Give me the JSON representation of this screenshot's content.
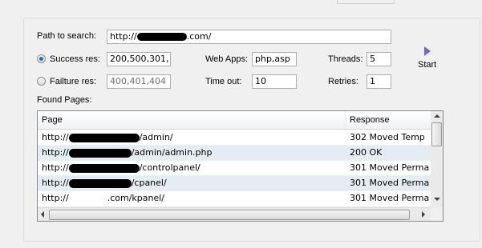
{
  "form": {
    "path_label": "Path to search:",
    "path_value_prefix": "http://",
    "path_value_suffix": ".com/",
    "success_label": "Success res:",
    "success_value": "200,500,301,",
    "failure_label": "Failture res:",
    "failure_value": "400,401,404",
    "webapps_label": "Web Apps:",
    "webapps_value": "php,asp",
    "timeout_label": "Time out:",
    "timeout_value": "10",
    "threads_label": "Threads:",
    "threads_value": "5",
    "retries_label": "Retries:",
    "retries_value": "1",
    "start_label": "Start",
    "found_label": "Found Pages:",
    "selected_mode": "success"
  },
  "table": {
    "headers": [
      "Page",
      "Response"
    ],
    "rows": [
      {
        "prefix": "http://",
        "suffix": "/admin/",
        "response": "302 Moved Temp"
      },
      {
        "prefix": "http://",
        "suffix": "/admin/admin.php",
        "response": "200 OK"
      },
      {
        "prefix": "http://",
        "suffix": "/controlpanel/",
        "response": "301 Moved Perma"
      },
      {
        "prefix": "http://",
        "suffix": "/cpanel/",
        "response": "301 Moved Perma"
      },
      {
        "prefix": "http://",
        "suffix": ".com/kpanel/",
        "response": "301 Moved Perma"
      }
    ]
  },
  "icons": {
    "start": "play-triangle-icon"
  },
  "colors": {
    "accent": "#7a5fd0",
    "row_alt": "#e4edf1",
    "radio_dot": "#2a6cc4"
  }
}
